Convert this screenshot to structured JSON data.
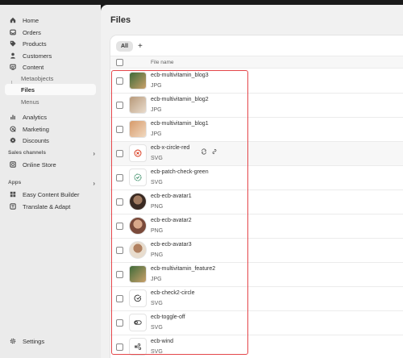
{
  "sidebar": {
    "items": [
      {
        "label": "Home",
        "icon": "home-icon"
      },
      {
        "label": "Orders",
        "icon": "inbox-icon"
      },
      {
        "label": "Products",
        "icon": "tag-icon"
      },
      {
        "label": "Customers",
        "icon": "person-icon"
      },
      {
        "label": "Content",
        "icon": "content-icon"
      },
      {
        "label": "Metaobjects"
      },
      {
        "label": "Files"
      },
      {
        "label": "Menus"
      },
      {
        "label": "Analytics",
        "icon": "bar-chart-icon"
      },
      {
        "label": "Marketing",
        "icon": "target-icon"
      },
      {
        "label": "Discounts",
        "icon": "discount-icon"
      }
    ],
    "sales_channels_label": "Sales channels",
    "online_store_label": "Online Store",
    "apps_label": "Apps",
    "apps": [
      {
        "label": "Easy Content Builder"
      },
      {
        "label": "Translate & Adapt"
      }
    ],
    "settings_label": "Settings"
  },
  "main": {
    "title": "Files",
    "tab_all": "All",
    "tab_add": "+",
    "column_file_name": "File name",
    "files": [
      {
        "name": "ecb-multivitamin_blog3",
        "type": "JPG",
        "thumb": "photo"
      },
      {
        "name": "ecb-multivitamin_blog2",
        "type": "JPG",
        "thumb": "photo"
      },
      {
        "name": "ecb-multivitamin_blog1",
        "type": "JPG",
        "thumb": "photo"
      },
      {
        "name": "ecb-x-circle-red",
        "type": "SVG",
        "thumb": "x-circle-red-icon"
      },
      {
        "name": "ecb-patch-check-green",
        "type": "SVG",
        "thumb": "patch-check-green-icon"
      },
      {
        "name": "ecb-ecb-avatar1",
        "type": "PNG",
        "thumb": "avatar"
      },
      {
        "name": "ecb-ecb-avatar2",
        "type": "PNG",
        "thumb": "avatar"
      },
      {
        "name": "ecb-ecb-avatar3",
        "type": "PNG",
        "thumb": "avatar"
      },
      {
        "name": "ecb-multivitamin_feature2",
        "type": "JPG",
        "thumb": "photo"
      },
      {
        "name": "ecb-check2-circle",
        "type": "SVG",
        "thumb": "check-circle-icon"
      },
      {
        "name": "ecb-toggle-off",
        "type": "SVG",
        "thumb": "toggle-off-icon"
      },
      {
        "name": "ecb-wind",
        "type": "SVG",
        "thumb": "wind-icon"
      }
    ]
  },
  "colors": {
    "highlight": "#e4464a",
    "sidebar_bg": "#ebebeb",
    "main_bg": "#f1f1f1"
  }
}
